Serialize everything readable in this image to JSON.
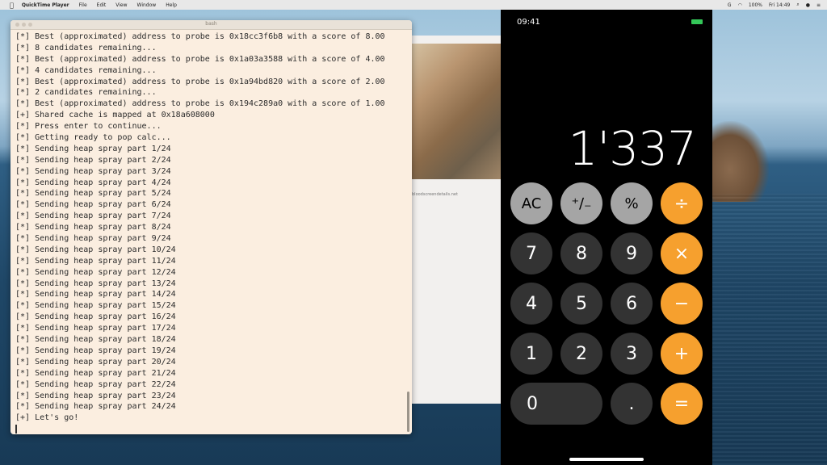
{
  "menubar": {
    "apple": "",
    "app_name": "QuickTime Player",
    "items": [
      "File",
      "Edit",
      "View",
      "Window",
      "Help"
    ],
    "right": [
      "G",
      "100%",
      "Fri 14:49"
    ]
  },
  "photo_window": {
    "caption": "bloodscreendetails.net"
  },
  "terminal": {
    "title": "bash",
    "lines": [
      "[*] Best (approximated) address to probe is 0x18cc3f6b8 with a score of 8.00",
      "[*] 8 candidates remaining...",
      "[*] Best (approximated) address to probe is 0x1a03a3588 with a score of 4.00",
      "[*] 4 candidates remaining...",
      "[*] Best (approximated) address to probe is 0x1a94bd820 with a score of 2.00",
      "[*] 2 candidates remaining...",
      "[*] Best (approximated) address to probe is 0x194c289a0 with a score of 1.00",
      "[+] Shared cache is mapped at 0x18a608000",
      "[*] Press enter to continue...",
      "[*] Getting ready to pop calc...",
      "[*] Sending heap spray part 1/24",
      "[*] Sending heap spray part 2/24",
      "[*] Sending heap spray part 3/24",
      "[*] Sending heap spray part 4/24",
      "[*] Sending heap spray part 5/24",
      "[*] Sending heap spray part 6/24",
      "[*] Sending heap spray part 7/24",
      "[*] Sending heap spray part 8/24",
      "[*] Sending heap spray part 9/24",
      "[*] Sending heap spray part 10/24",
      "[*] Sending heap spray part 11/24",
      "[*] Sending heap spray part 12/24",
      "[*] Sending heap spray part 13/24",
      "[*] Sending heap spray part 14/24",
      "[*] Sending heap spray part 15/24",
      "[*] Sending heap spray part 16/24",
      "[*] Sending heap spray part 17/24",
      "[*] Sending heap spray part 18/24",
      "[*] Sending heap spray part 19/24",
      "[*] Sending heap spray part 20/24",
      "[*] Sending heap spray part 21/24",
      "[*] Sending heap spray part 22/24",
      "[*] Sending heap spray part 23/24",
      "[*] Sending heap spray part 24/24",
      "[+] Let's go!"
    ]
  },
  "phone": {
    "time": "09:41",
    "display": "1'337",
    "keys": {
      "ac": "AC",
      "plus_minus": "⁺∕₋",
      "percent": "%",
      "divide": "÷",
      "seven": "7",
      "eight": "8",
      "nine": "9",
      "multiply": "×",
      "four": "4",
      "five": "5",
      "six": "6",
      "minus": "−",
      "one": "1",
      "two": "2",
      "three": "3",
      "plus": "+",
      "zero": "0",
      "decimal": ".",
      "equals": "="
    },
    "colors": {
      "function_key": "#a5a5a5",
      "number_key": "#333333",
      "operator_key": "#f6a02e"
    }
  }
}
